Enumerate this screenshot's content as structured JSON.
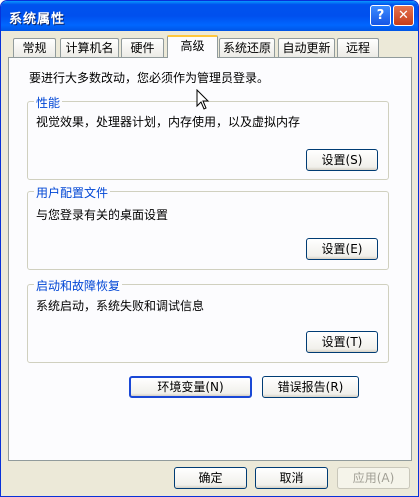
{
  "window": {
    "title": "系统属性",
    "help_glyph": "?",
    "close_glyph": "✕"
  },
  "tabs": [
    {
      "label": "常规"
    },
    {
      "label": "计算机名"
    },
    {
      "label": "硬件"
    },
    {
      "label": "高级",
      "active": true
    },
    {
      "label": "系统还原"
    },
    {
      "label": "自动更新"
    },
    {
      "label": "远程"
    }
  ],
  "advanced": {
    "intro": "要进行大多数改动，您必须作为管理员登录。",
    "performance": {
      "title": "性能",
      "description": "视觉效果，处理器计划，内存使用，以及虚拟内存",
      "button": "设置(S)"
    },
    "profiles": {
      "title": "用户配置文件",
      "description": "与您登录有关的桌面设置",
      "button": "设置(E)"
    },
    "startup": {
      "title": "启动和故障恢复",
      "description": "系统启动，系统失败和调试信息",
      "button": "设置(T)"
    },
    "env_button": "环境变量(N)",
    "error_button": "错误报告(R)"
  },
  "footer": {
    "ok": "确定",
    "cancel": "取消",
    "apply": "应用(A)"
  },
  "colors": {
    "titlebar": "#0054e3",
    "group_title": "#0046d5",
    "active_tab_accent": "#ffc73c"
  }
}
